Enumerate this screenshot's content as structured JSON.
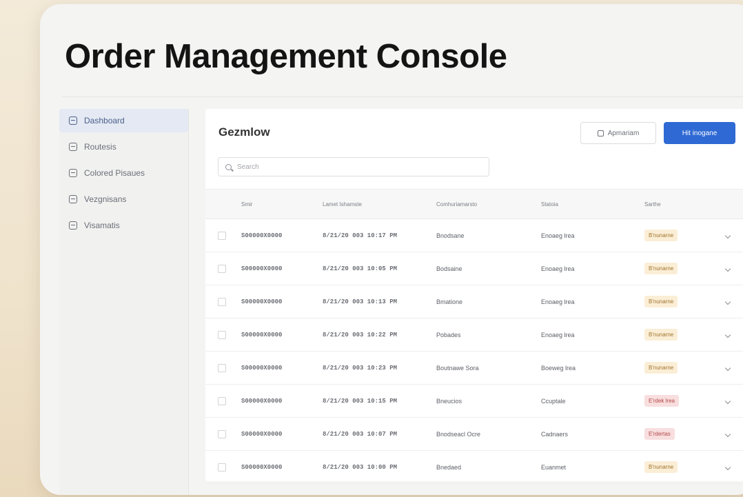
{
  "app": {
    "title": "Order Management Console"
  },
  "sidebar": {
    "items": [
      {
        "label": "Dashboard",
        "icon": "home-icon",
        "active": true
      },
      {
        "label": "Routesis",
        "icon": "box-icon"
      },
      {
        "label": "Colored Pisaues",
        "icon": "layers-icon"
      },
      {
        "label": "Vezgnisans",
        "icon": "box-icon"
      },
      {
        "label": "Visamatis",
        "icon": "box-icon"
      }
    ]
  },
  "panel": {
    "title": "Gezmlow",
    "secondary_button": "Apmariam",
    "primary_button": "Hit inogane",
    "search_placeholder": "Search"
  },
  "table": {
    "headers": [
      "Smir",
      "Lamet Ishamste",
      "Comhuriamarsto",
      "Statoia",
      "Sarthe"
    ],
    "rows": [
      {
        "id": "S00000X0000",
        "date": "8/21/20 003 10:17 PM",
        "customer": "Bnodsane",
        "shipping": "Enoaeg lrea",
        "status": "B'nunarne",
        "status_type": "warn"
      },
      {
        "id": "S00000X0000",
        "date": "8/21/20 003 10:05 PM",
        "customer": "Bodsaine",
        "shipping": "Enoaeg lrea",
        "status": "B'nunarne",
        "status_type": "warn"
      },
      {
        "id": "S00000X0000",
        "date": "8/21/20 003 10:13 PM",
        "customer": "Bmatione",
        "shipping": "Enoaeg lrea",
        "status": "B'nunarne",
        "status_type": "warn"
      },
      {
        "id": "S00000X0000",
        "date": "8/21/20 003 10:22 PM",
        "customer": "Pobades",
        "shipping": "Enoaeg lrea",
        "status": "B'nunarne",
        "status_type": "warn"
      },
      {
        "id": "S00000X0000",
        "date": "8/21/20 003 10:23 PM",
        "customer": "Boutnawe Sora",
        "shipping": "Boeweg lrea",
        "status": "B'nunarne",
        "status_type": "warn"
      },
      {
        "id": "S00000X0000",
        "date": "8/21/20 003 10:15 PM",
        "customer": "Bneucios",
        "shipping": "Ccuptale",
        "status": "E'rdek lrea",
        "status_type": "err"
      },
      {
        "id": "S00000X0000",
        "date": "8/21/20 003 10:07 PM",
        "customer": "Bnodseacl Ocre",
        "shipping": "Cadnaers",
        "status": "E'rdertas",
        "status_type": "err"
      },
      {
        "id": "S00000X0000",
        "date": "8/21/20 003 10:00 PM",
        "customer": "Bnedaed",
        "shipping": "Euanmet",
        "status": "B'nunarne",
        "status_type": "warn"
      }
    ]
  }
}
